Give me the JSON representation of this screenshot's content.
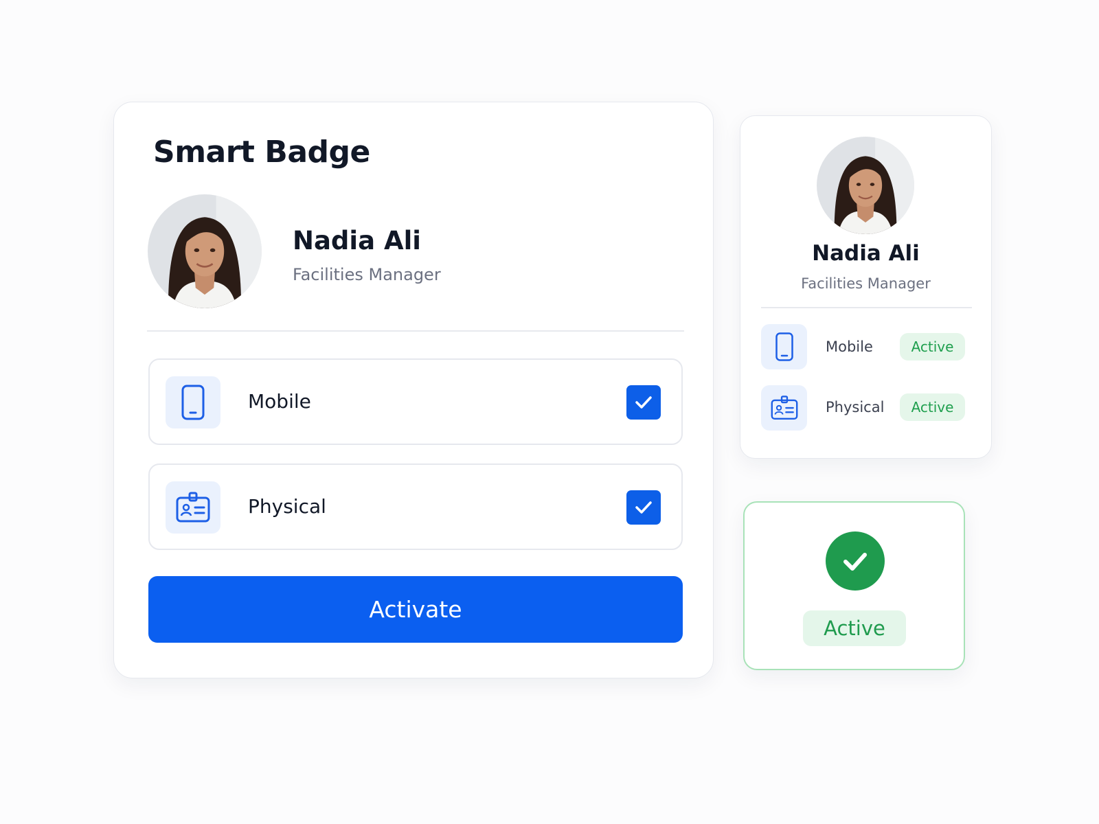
{
  "main_card": {
    "title": "Smart Badge",
    "name": "Nadia Ali",
    "role": "Facilities Manager",
    "options": [
      {
        "label": "Mobile",
        "icon": "phone-icon",
        "checked": true
      },
      {
        "label": "Physical",
        "icon": "id-card-icon",
        "checked": true
      }
    ],
    "activate_label": "Activate"
  },
  "side_card": {
    "name": "Nadia Ali",
    "role": "Facilities Manager",
    "items": [
      {
        "label": "Mobile",
        "icon": "phone-icon",
        "status": "Active"
      },
      {
        "label": "Physical",
        "icon": "id-card-icon",
        "status": "Active"
      }
    ]
  },
  "status_card": {
    "icon": "check-circle-icon",
    "status": "Active"
  },
  "colors": {
    "primary": "#0b5ff0",
    "success": "#1f9b4e",
    "success_bg": "#e4f6ea",
    "icon_bg": "#eaf1fd"
  }
}
